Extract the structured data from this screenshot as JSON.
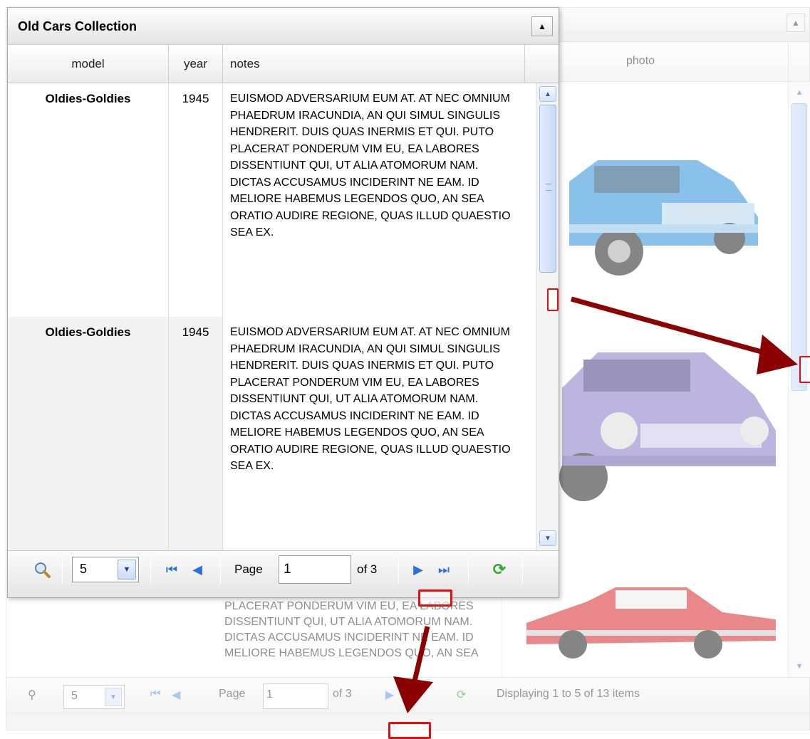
{
  "front_grid": {
    "title": "Old Cars Collection",
    "collapse_icon": "triangle-up-icon",
    "columns": [
      "model",
      "year",
      "notes"
    ],
    "rows": [
      {
        "model": "Oldies-Goldies",
        "year": "1945",
        "notes": "EUISMOD ADVERSARIUM EUM AT. AT NEC OMNIUM PHAEDRUM IRACUNDIA, AN QUI SIMUL SINGULIS HENDRERIT. DUIS QUAS INERMIS ET QUI. PUTO PLACERAT PONDERUM VIM EU, EA LABORES DISSENTIUNT QUI, UT ALIA ATOMORUM NAM. DICTAS ACCUSAMUS INCIDERINT NE EAM. ID MELIORE HABEMUS LEGENDOS QUO, AN SEA ORATIO AUDIRE REGIONE, QUAS ILLUD QUAESTIO SEA EX."
      },
      {
        "model": "Oldies-Goldies",
        "year": "1945",
        "notes": "EUISMOD ADVERSARIUM EUM AT. AT NEC OMNIUM PHAEDRUM IRACUNDIA, AN QUI SIMUL SINGULIS HENDRERIT. DUIS QUAS INERMIS ET QUI. PUTO PLACERAT PONDERUM VIM EU, EA LABORES DISSENTIUNT QUI, UT ALIA ATOMORUM NAM. DICTAS ACCUSAMUS INCIDERINT NE EAM. ID MELIORE HABEMUS LEGENDOS QUO, AN SEA ORATIO AUDIRE REGIONE, QUAS ILLUD QUAESTIO SEA EX."
      }
    ],
    "pager": {
      "page_size": "5",
      "page_label": "Page",
      "page_value": "1",
      "of_label": "of 3"
    }
  },
  "back_grid": {
    "photo_header": "photo",
    "notes_fragment": "PLACERAT PONDERUM VIM EU, EA LABORES DISSENTIUNT QUI, UT ALIA ATOMORUM NAM. DICTAS ACCUSAMUS INCIDERINT NE EAM. ID MELIORE HABEMUS LEGENDOS QUO, AN SEA",
    "pager": {
      "page_size": "5",
      "page_label": "Page",
      "page_value": "1",
      "of_label": "of 3",
      "status": "Displaying 1 to 5 of 13 items"
    }
  },
  "colors": {
    "annotation": "#e01010",
    "arrow": "#8b0000",
    "nav_blue": "#2e6fd8",
    "refresh_green": "#39a53a"
  }
}
